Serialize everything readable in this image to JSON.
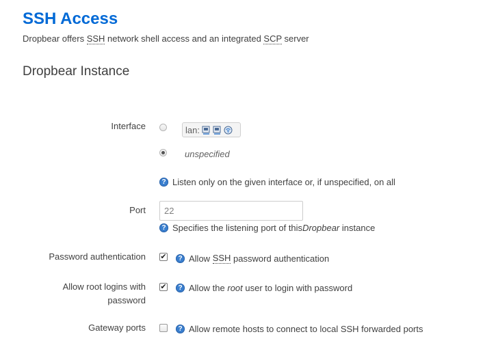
{
  "page": {
    "title": "SSH Access",
    "description_parts": [
      "Dropbear offers ",
      "SSH",
      " network shell access and an integrated ",
      "SCP",
      " server"
    ]
  },
  "section": {
    "title": "Dropbear Instance"
  },
  "interface": {
    "label": "Interface",
    "option_lan": "lan:",
    "option_unspecified": "unspecified",
    "selected": "unspecified",
    "lan_icons": [
      "ethernet-port-icon",
      "ethernet-port-icon",
      "wifi-icon"
    ],
    "help": "Listen only on the given interface or, if unspecified, on all"
  },
  "port": {
    "label": "Port",
    "value": "22",
    "help_parts": [
      "Specifies the listening port of this ",
      "Dropbear",
      " instance"
    ]
  },
  "password_auth": {
    "label": "Password authentication",
    "checked": true,
    "help_parts": [
      "Allow ",
      "SSH",
      " password authentication"
    ]
  },
  "root_login": {
    "label_line1": "Allow root logins with",
    "label_line2": "password",
    "checked": true,
    "help_parts": [
      "Allow the ",
      "root",
      " user to login with password"
    ]
  },
  "gateway_ports": {
    "label": "Gateway ports",
    "checked": false,
    "help": "Allow remote hosts to connect to local SSH forwarded ports"
  }
}
